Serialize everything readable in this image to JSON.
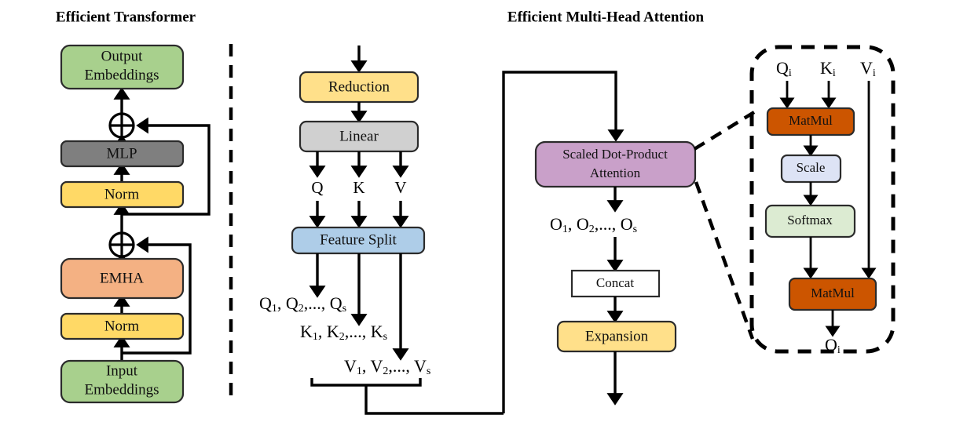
{
  "panels": {
    "left": {
      "title": "Efficient Transformer",
      "nodes": [
        {
          "id": "output-embeddings",
          "label_line1": "Output",
          "label_line2": "Embeddings",
          "color": "#a8d08d"
        },
        {
          "id": "mlp",
          "label": "MLP",
          "color": "#7f7f7f"
        },
        {
          "id": "norm-top",
          "label": "Norm",
          "color": "#ffd966"
        },
        {
          "id": "emha",
          "label": "EMHA",
          "color": "#f4b183"
        },
        {
          "id": "norm-bottom",
          "label": "Norm",
          "color": "#ffd966"
        },
        {
          "id": "input-embeddings",
          "label_line1": "Input",
          "label_line2": "Embeddings",
          "color": "#a8d08d"
        }
      ],
      "adders": [
        "⊕",
        "⊕"
      ]
    },
    "middle": {
      "nodes": [
        {
          "id": "reduction",
          "label": "Reduction",
          "color": "#ffe08a"
        },
        {
          "id": "linear",
          "label": "Linear",
          "color": "#d0d0d0"
        },
        {
          "id": "feature-split",
          "label": "Feature Split",
          "color": "#aecde8"
        }
      ],
      "qkv_labels": [
        "Q",
        "K",
        "V"
      ],
      "sequences": [
        {
          "id": "q-seq",
          "head": "Q",
          "text_main": "Q",
          "full": "Q1, Q2,..., Qs"
        },
        {
          "id": "k-seq",
          "head": "K",
          "text_main": "K",
          "full": "K1, K2,..., Ks"
        },
        {
          "id": "v-seq",
          "head": "V",
          "text_main": "V",
          "full": "V1, V2,..., Vs"
        }
      ]
    },
    "right": {
      "title": "Efficient Multi-Head Attention",
      "nodes": [
        {
          "id": "scaled-dot-product-attention",
          "label_line1": "Scaled Dot-Product",
          "label_line2": "Attention",
          "color": "#c9a0c9"
        },
        {
          "id": "concat",
          "label": "Concat",
          "color": "#ffffff"
        },
        {
          "id": "expansion",
          "label": "Expansion",
          "color": "#ffe08a"
        }
      ],
      "sequences": [
        {
          "id": "o-seq",
          "full": "O1, O2,..., Os"
        }
      ]
    },
    "detail": {
      "inputs": [
        "Q",
        "K",
        "V"
      ],
      "input_subscript": "i",
      "nodes": [
        {
          "id": "matmul-qk",
          "label": "MatMul",
          "color": "#cc5500"
        },
        {
          "id": "scale",
          "label": "Scale",
          "color": "#dde3f5"
        },
        {
          "id": "softmax",
          "label": "Softmax",
          "color": "#dcebd2"
        },
        {
          "id": "matmul-v",
          "label": "MatMul",
          "color": "#cc5500"
        }
      ],
      "output": "O",
      "output_subscript": "i"
    }
  },
  "colors": {
    "green": "#a8d08d",
    "gray_dark": "#7f7f7f",
    "yellow": "#ffd966",
    "orange_light": "#f4b183",
    "yellow_light": "#ffe08a",
    "gray_light": "#d0d0d0",
    "blue_light": "#aecde8",
    "purple": "#c9a0c9",
    "white": "#ffffff",
    "orange_dark": "#cc5500",
    "lavender": "#dde3f5",
    "green_pale": "#dcebd2",
    "stroke": "#2b2b2b"
  }
}
